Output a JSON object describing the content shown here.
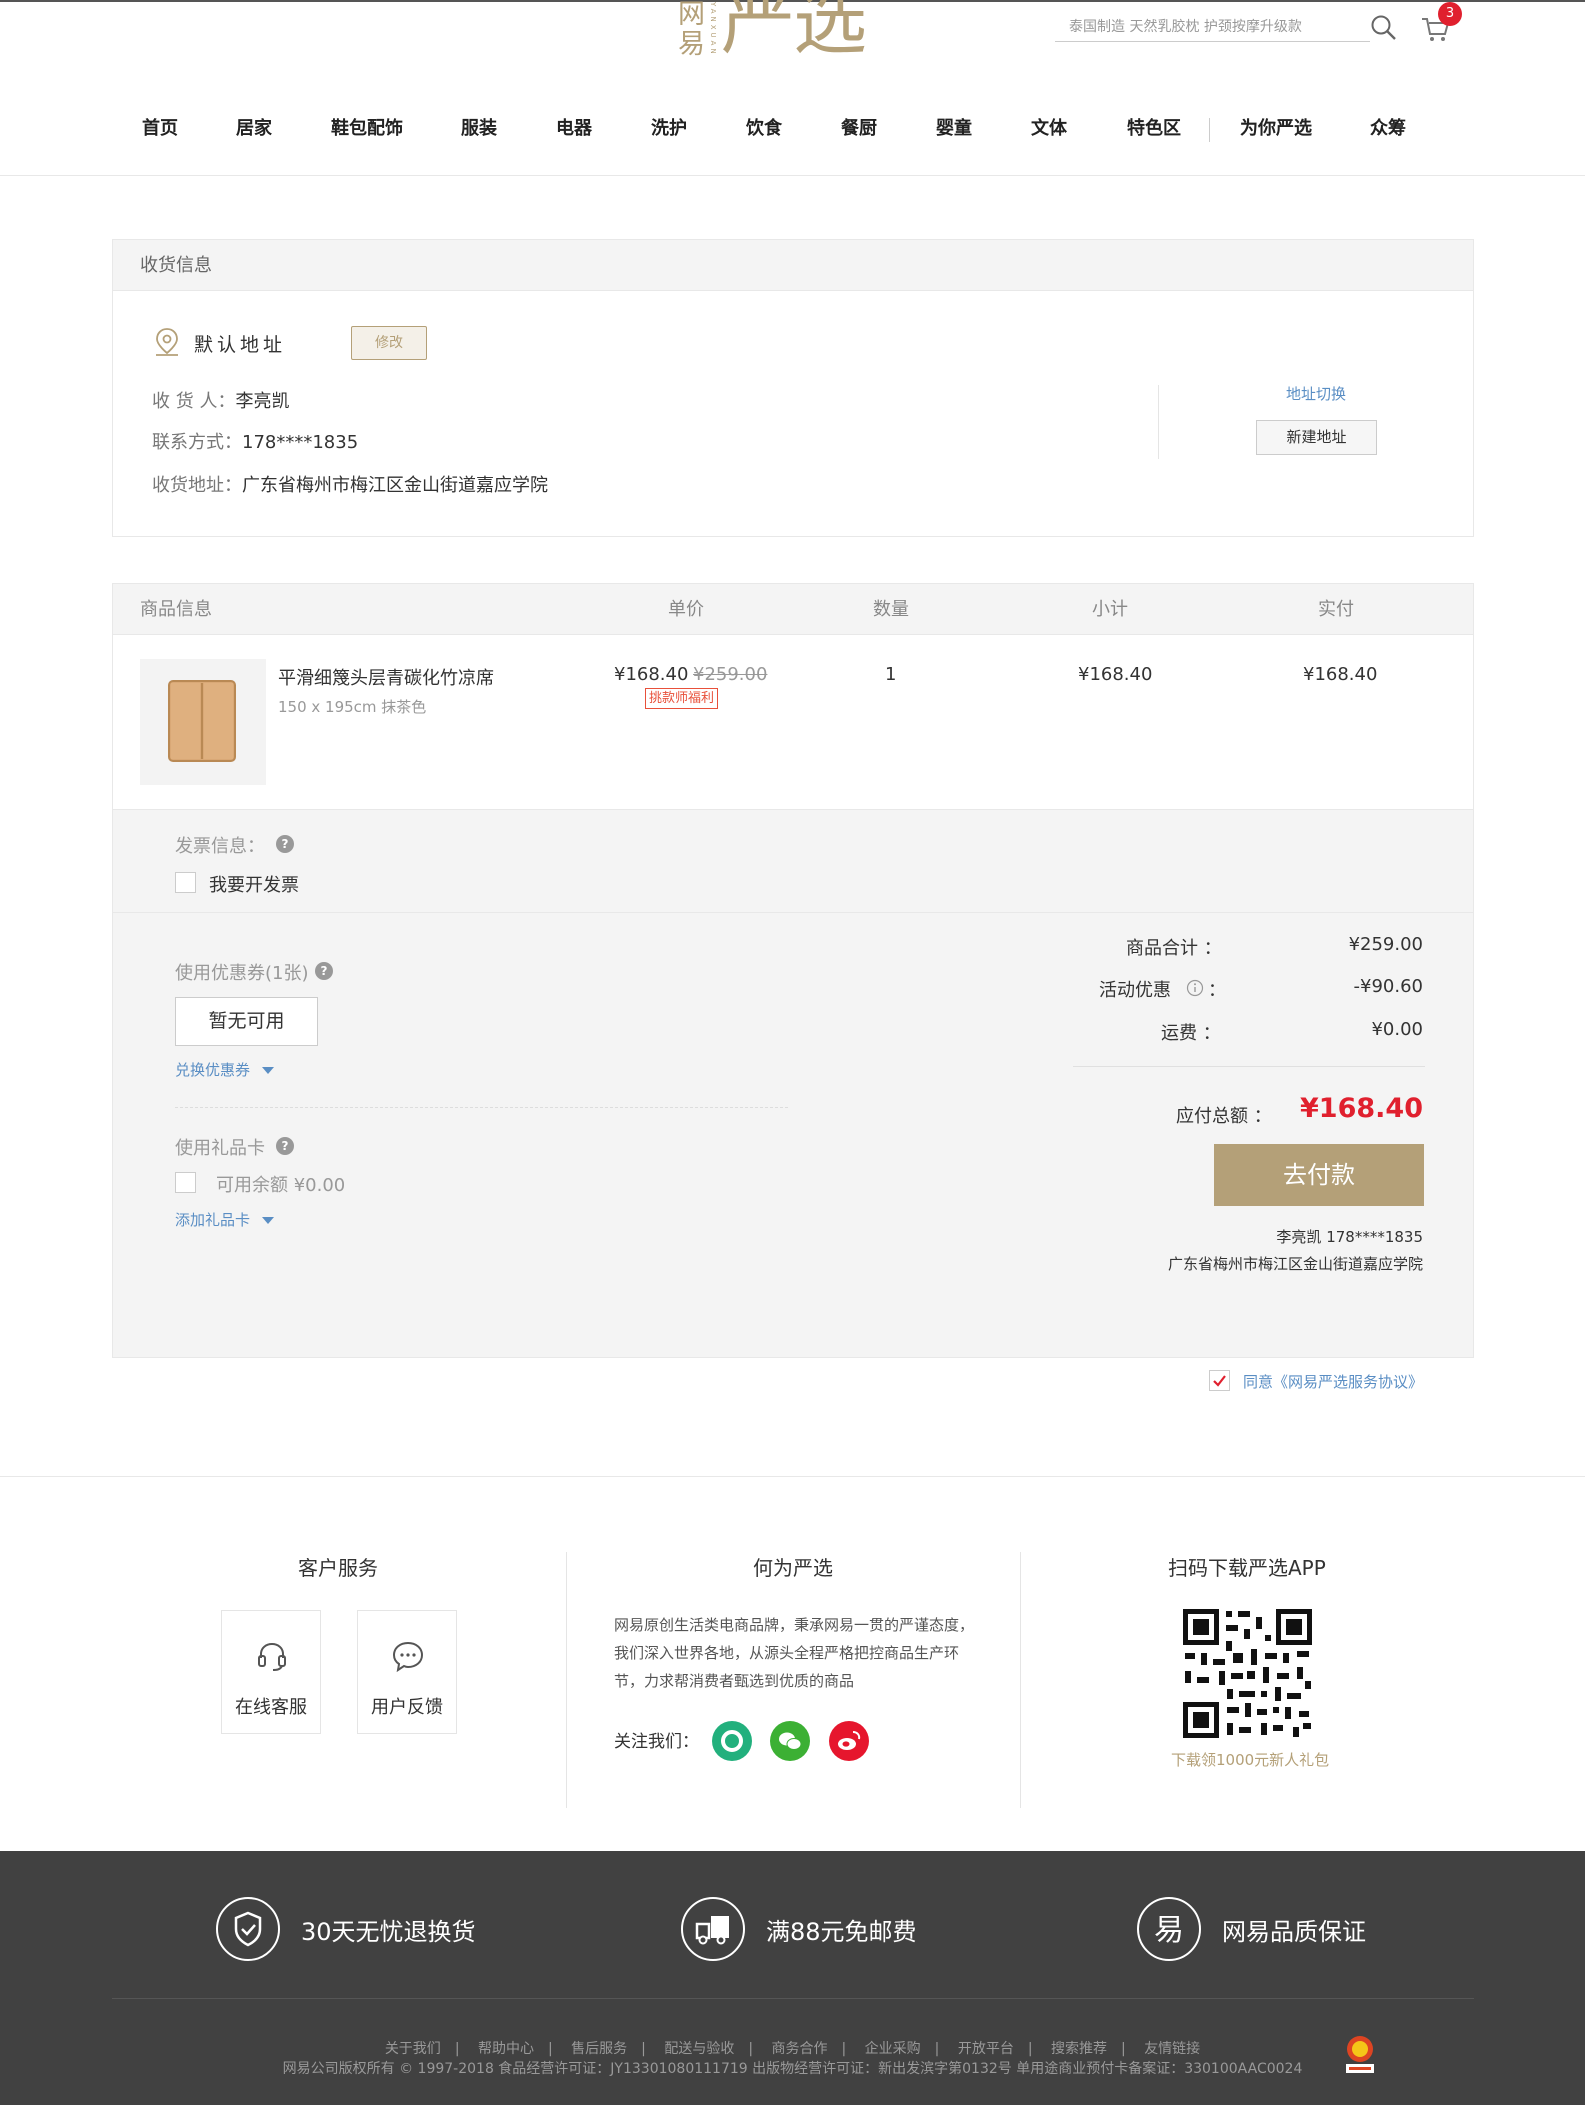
{
  "header": {
    "logo_small": [
      "网",
      "易"
    ],
    "logo_latin": "YANXUAN",
    "logo_big": "严选",
    "search_placeholder": "泰国制造 天然乳胶枕 护颈按摩升级款",
    "cart_count": "3",
    "nav": [
      "首页",
      "居家",
      "鞋包配饰",
      "服装",
      "电器",
      "洗护",
      "饮食",
      "餐厨",
      "婴童",
      "文体",
      "特色区",
      "为你严选",
      "众筹"
    ]
  },
  "shipping": {
    "title": "收货信息",
    "default_label": "默认地址",
    "edit_label": "修改",
    "receiver_label": "收 货 人：",
    "receiver": "李亮凯",
    "contact_label": "联系方式：",
    "contact": "178****1835",
    "address_label": "收货地址：",
    "address": "广东省梅州市梅江区金山街道嘉应学院",
    "switch_label": "地址切换",
    "new_label": "新建地址"
  },
  "goods": {
    "headers": [
      "商品信息",
      "单价",
      "数量",
      "小计",
      "实付"
    ],
    "item": {
      "name": "平滑细篾头层青碳化竹凉席",
      "spec": "150 x 195cm 抹茶色",
      "price": "¥168.40",
      "original_price": "¥259.00",
      "promo": "挑款师福利",
      "quantity": "1",
      "subtotal": "¥168.40",
      "paid": "¥168.40"
    }
  },
  "invoice": {
    "label": "发票信息：",
    "checkbox_label": "我要开发票"
  },
  "coupon": {
    "label": "使用优惠券(1张)",
    "button": "暂无可用",
    "exchange_link": "兑换优惠券"
  },
  "gift_card": {
    "label": "使用礼品卡",
    "balance_label": "可用余额 ¥0.00",
    "add_link": "添加礼品卡"
  },
  "summary": {
    "goods_total_label": "商品合计 ：",
    "goods_total": "¥259.00",
    "discount_label": "活动优惠",
    "discount_colon": "：",
    "discount": "-¥90.60",
    "shipping_label": "运费 ：",
    "shipping": "¥0.00",
    "payable_label": "应付总额 ：",
    "payable": "¥168.40",
    "pay_button": "去付款",
    "recv_name_phone": "李亮凯   178****1835",
    "recv_address": "广东省梅州市梅江区金山街道嘉应学院"
  },
  "agreement": "同意《网易严选服务协议》",
  "footer": {
    "service_title": "客户服务",
    "online_service": "在线客服",
    "feedback": "用户反馈",
    "about_title": "何为严选",
    "about_text": "网易原创生活类电商品牌，秉承网易一贯的严谨态度，我们深入世界各地，从源头全程严格把控商品生产环节，力求帮消费者甄选到优质的商品",
    "follow_label": "关注我们：",
    "app_title": "扫码下载严选APP",
    "qr_caption": "下载领1000元新人礼包",
    "promises": [
      "30天无忧退换货",
      "满88元免邮费",
      "网易品质保证"
    ],
    "links": [
      "关于我们",
      "帮助中心",
      "售后服务",
      "配送与验收",
      "商务合作",
      "企业采购",
      "开放平台",
      "搜索推荐",
      "友情链接"
    ],
    "copyright": "网易公司版权所有 © 1997-2018   食品经营许可证：JY13301080111719 出版物经营许可证：新出发滨字第0132号 单用途商业预付卡备案证：330100AAC0024"
  },
  "colors": {
    "brand_gold": "#b4a078",
    "price_red": "#e0202e",
    "link_blue": "#5a8ec4",
    "footer_dark": "#414141"
  }
}
